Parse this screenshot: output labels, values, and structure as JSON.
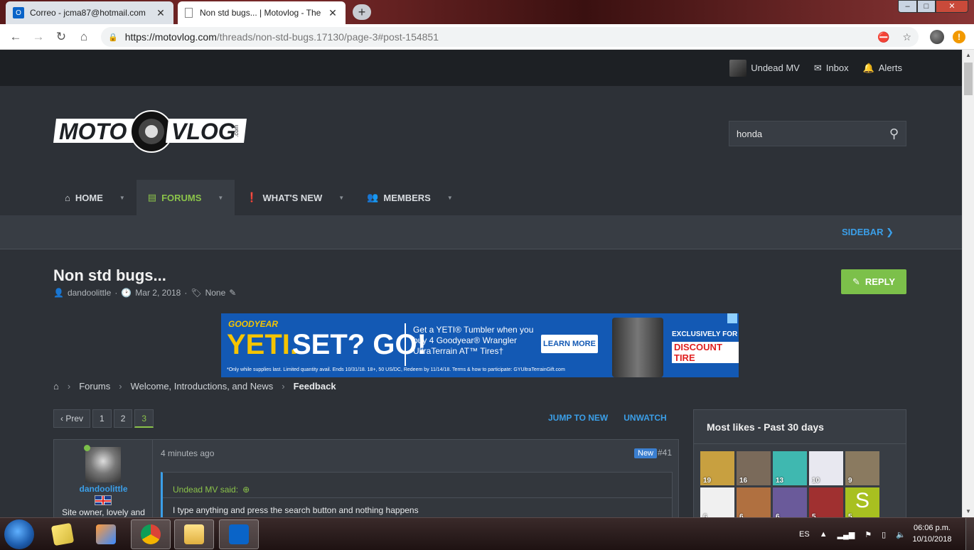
{
  "browser": {
    "tabs": [
      {
        "title": "Correo - jcma87@hotmail.com",
        "active": false
      },
      {
        "title": "Non std bugs... | Motovlog - The",
        "active": true
      }
    ],
    "url_host": "https://motovlog.com",
    "url_path": "/threads/non-std-bugs.17130/page-3#post-154851"
  },
  "user_bar": {
    "username": "Undead MV",
    "inbox": "Inbox",
    "alerts": "Alerts"
  },
  "logo": {
    "left_text": "MOTO",
    "right_text": "VLOG",
    "suffix": ".com"
  },
  "search": {
    "value": "honda"
  },
  "nav": {
    "home": "HOME",
    "forums": "FORUMS",
    "whats_new": "WHAT'S NEW",
    "members": "MEMBERS",
    "sidebar": "SIDEBAR"
  },
  "thread": {
    "title": "Non std bugs...",
    "author": "dandoolittle",
    "date": "Mar 2, 2018",
    "tags": "None",
    "reply_label": "REPLY"
  },
  "ad": {
    "brand": "GOODYEAR",
    "headline_yellow": "YETI.",
    "headline_white": "SET? GO!",
    "copy": "Get a YETI® Tumbler when you buy 4 Goodyear® Wrangler UltraTerrain AT™ Tires†",
    "cta": "LEARN MORE",
    "exclusive": "EXCLUSIVELY FOR",
    "retailer": "DISCOUNT TIRE",
    "fine_print": "*Only while supplies last. Limited quantity avail. Ends 10/31/18. 18+, 50 US/DC, Redeem by 11/14/18. Terms & how to participate: GYUltraTerrainGift.com"
  },
  "breadcrumbs": [
    "Forums",
    "Welcome, Introductions, and News",
    "Feedback"
  ],
  "pagination": {
    "prev": "Prev",
    "pages": [
      "1",
      "2",
      "3"
    ],
    "current": "3"
  },
  "thread_actions": {
    "jump_to_new": "JUMP TO NEW",
    "unwatch": "UNWATCH"
  },
  "post": {
    "username": "dandoolittle",
    "user_title": "Site owner, lovely and",
    "time": "4 minutes ago",
    "badge": "New",
    "number": "#41",
    "quote_author": "Undead MV said:",
    "quote_text": "I type anything and press the search button and nothing happens"
  },
  "sidebar_block": {
    "title": "Most likes - Past 30 days",
    "members": [
      {
        "count": "19",
        "color": "#c8a040"
      },
      {
        "count": "16",
        "color": "#7a6a5a"
      },
      {
        "count": "13",
        "color": "#3fb8b0"
      },
      {
        "count": "10",
        "color": "#e8e8f0"
      },
      {
        "count": "9",
        "color": "#8a7a60"
      },
      {
        "count": "6",
        "color": "#f0f0f0"
      },
      {
        "count": "6",
        "color": "#b07040"
      },
      {
        "count": "6",
        "color": "#6a5a9a"
      },
      {
        "count": "5",
        "color": "#a03030"
      },
      {
        "count": "5",
        "color": "#a8c020"
      }
    ],
    "last_letter": "S"
  },
  "taskbar": {
    "lang": "ES",
    "time": "06:06 p.m.",
    "date": "10/10/2018"
  },
  "colors": {
    "accent_green": "#8bc34a",
    "link_blue": "#3b9fe8",
    "bg": "#2d3137"
  }
}
